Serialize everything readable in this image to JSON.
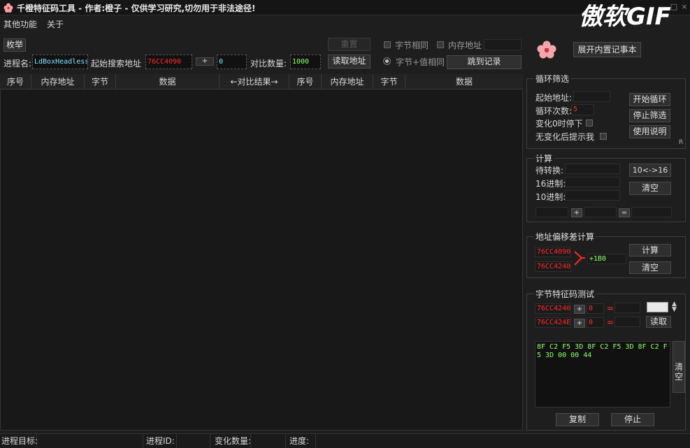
{
  "window": {
    "title": "千橙特征码工具 - 作者:橙子 - 仅供学习研究,切勿用于非法途径!",
    "watermark": "傲软GIF",
    "controls": [
      "–",
      "□",
      "×"
    ]
  },
  "menu": {
    "items": [
      "其他功能",
      "关于"
    ]
  },
  "top": {
    "enum_button": "枚举",
    "reset_button": "重置",
    "process_label": "进程名:",
    "process_value": "LdBoxHeadless",
    "start_addr_label": "起始搜索地址",
    "start_addr_value": "76CC4090",
    "plus": "+",
    "offset_value": "0",
    "compare_count_label": "对比数量:",
    "compare_count_value": "1000",
    "read_addr_button": "读取地址",
    "byte_same_label": "字节相同",
    "mem_addr_label": "内存地址",
    "byte_value_same_label": "字节+值相同",
    "jump_button": "跳到记录",
    "notepad_button": "展开内置记事本"
  },
  "table": {
    "headers": [
      "序号",
      "内存地址",
      "字节",
      "数据",
      "←对比结果→",
      "序号",
      "内存地址",
      "字节",
      "数据"
    ]
  },
  "loop": {
    "title": "循环筛选",
    "start_addr_label": "起始地址:",
    "count_label": "循环次数:",
    "count_value": "5",
    "stop_on_change_label": "变化0时停下",
    "notify_label": "无变化后提示我",
    "start_button": "开始循环",
    "stop_button": "停止筛选",
    "help_button": "使用说明",
    "corner": "R"
  },
  "calc": {
    "title": "计算",
    "pending_label": "待转换:",
    "hex_label": "16进制:",
    "dec_label": "10进制:",
    "convert_button": "10<->16",
    "clear_button": "清空",
    "plus": "+",
    "equals": "="
  },
  "offset": {
    "title": "地址偏移差计算",
    "addr1": "76CC4090",
    "addr2": "76CC4240",
    "diff": "+1B0",
    "calc_button": "计算",
    "clear_button": "清空"
  },
  "bytetest": {
    "title": "字节特征码测试",
    "addr1": "76CC4240",
    "addr2": "76CC424E",
    "plus": "+",
    "offset1": "0",
    "offset2": "0",
    "equals": "=",
    "read_button": "读取",
    "hex_text": "8F C2 F5 3D 8F C2 F5 3D 8F C2 F5 3D 00 00 44",
    "clear_button": "清空",
    "copy_button": "复制",
    "stop_button": "停止"
  },
  "status": {
    "target_label": "进程目标:",
    "pid_label": "进程ID:",
    "change_label": "变化数量:",
    "progress_label": "进度:"
  },
  "colors": {
    "addr_red": "#ff2a2a",
    "process_cyan": "#7fe3ff",
    "value_green": "#8dff6a"
  }
}
